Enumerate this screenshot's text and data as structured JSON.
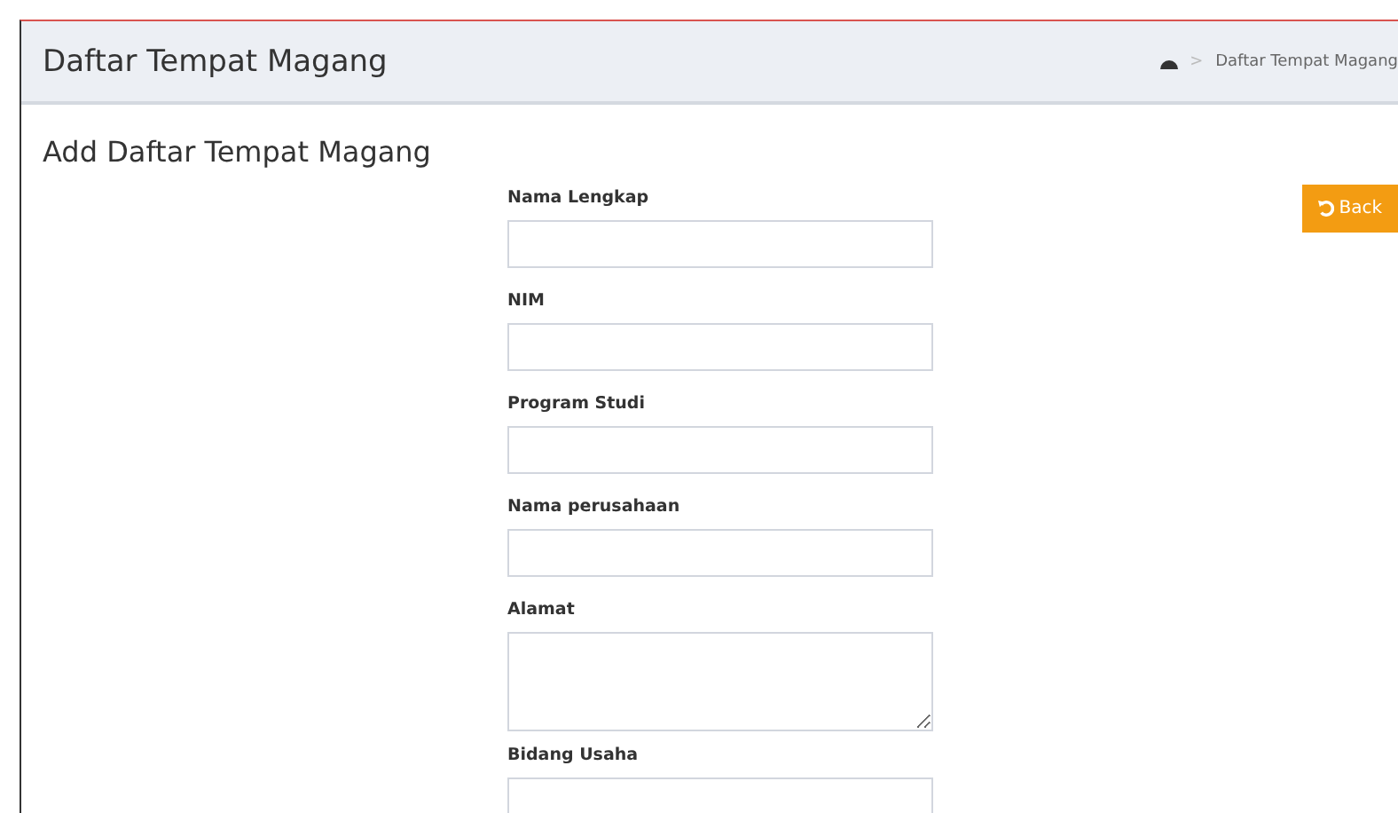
{
  "header": {
    "title": "Daftar Tempat Magang",
    "breadcrumb_separator": ">",
    "breadcrumb": [
      {
        "label": "Daftar Tempat Magang"
      }
    ]
  },
  "page_title": "Add Daftar Tempat Magang",
  "back_button": "Back",
  "fields": [
    {
      "label": "Nama Lengkap",
      "kind": "input"
    },
    {
      "label": "NIM",
      "kind": "input"
    },
    {
      "label": "Program Studi",
      "kind": "input"
    },
    {
      "label": "Nama perusahaan",
      "kind": "input"
    },
    {
      "label": "Alamat",
      "kind": "textarea"
    },
    {
      "label": "Bidang Usaha",
      "kind": "input"
    }
  ]
}
